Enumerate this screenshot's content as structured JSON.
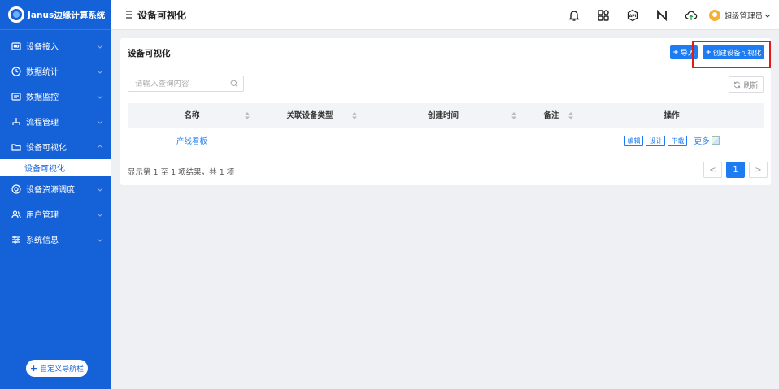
{
  "app": {
    "title": "Janus边缘计算系统"
  },
  "sidebar": {
    "items": [
      {
        "label": "设备接入",
        "icon": "device-icon"
      },
      {
        "label": "数据统计",
        "icon": "clock-icon"
      },
      {
        "label": "数据监控",
        "icon": "monitor-icon"
      },
      {
        "label": "流程管理",
        "icon": "flow-icon"
      },
      {
        "label": "设备可视化",
        "icon": "folder-icon",
        "expanded": true
      },
      {
        "label": "设备资源调度",
        "icon": "target-icon"
      },
      {
        "label": "用户管理",
        "icon": "users-icon"
      },
      {
        "label": "系统信息",
        "icon": "sliders-icon"
      }
    ],
    "submenu": {
      "label": "设备可视化"
    },
    "custom_nav": "自定义导航栏"
  },
  "header": {
    "title": "设备可视化",
    "user": "超级管理员",
    "tools": [
      "bell-icon",
      "apps-icon",
      "api-icon",
      "nfc-icon",
      "cloud-upload-icon"
    ],
    "api_text": "API"
  },
  "card": {
    "title": "设备可视化",
    "import_label": "导入",
    "create_label": "创建设备可视化",
    "search_placeholder": "请输入查询内容",
    "refresh_label": "刷新",
    "columns": [
      "名称",
      "关联设备类型",
      "创建时间",
      "备注",
      "操作"
    ],
    "rows": [
      {
        "name": "产线看板",
        "device_type": "",
        "created": "",
        "note": "",
        "ops": [
          "编辑",
          "设计",
          "下载"
        ],
        "more": "更多"
      }
    ],
    "summary": "显示第 1 至 1 项结果，共 1 项",
    "pagination": {
      "prev": "<",
      "current": "1",
      "next": ">"
    }
  },
  "colors": {
    "sidebar": "#1461d8",
    "primary": "#1e7cf2",
    "highlight": "#e31a1a"
  }
}
